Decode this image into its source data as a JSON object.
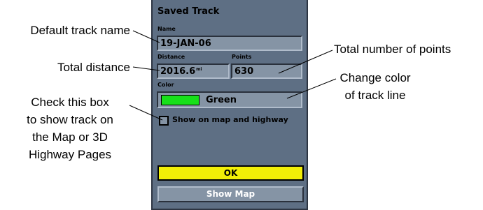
{
  "device": {
    "title": "Saved Track",
    "name_label": "Name",
    "name_value": "19-JAN-06",
    "distance_label": "Distance",
    "distance_value": "2016.6",
    "distance_unit": "mi",
    "points_label": "Points",
    "points_value": "630",
    "color_label": "Color",
    "color_value": "Green",
    "color_swatch": "#17e01a",
    "show_on_map_label": "Show on map and highway",
    "show_on_map_checked": false,
    "ok_button": "OK",
    "show_map_button": "Show Map"
  },
  "callouts": {
    "default_track_name": "Default track name",
    "total_distance": "Total distance",
    "checkbox_help": [
      "Check this box",
      "to show track on",
      "the Map or 3D",
      "Highway Pages"
    ],
    "total_points": "Total number of points",
    "change_color": [
      "Change color",
      "of track line"
    ]
  }
}
